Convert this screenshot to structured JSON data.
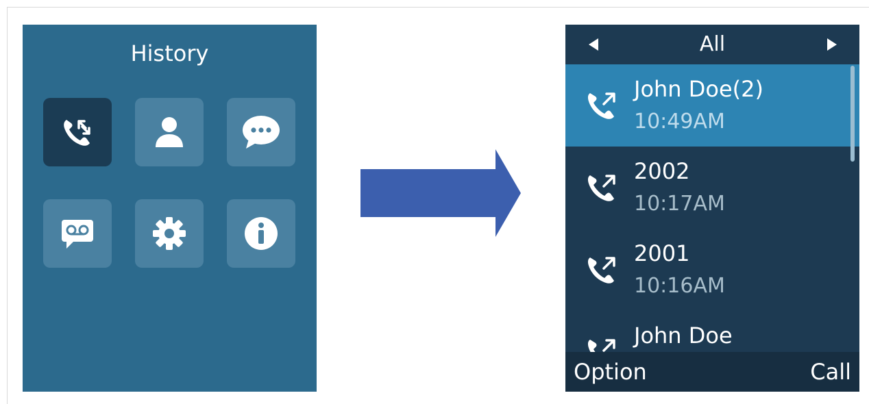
{
  "left_screen": {
    "title": "History",
    "tiles": [
      {
        "icon": "call-history-icon",
        "selected": true
      },
      {
        "icon": "contacts-icon",
        "selected": false
      },
      {
        "icon": "messages-icon",
        "selected": false
      },
      {
        "icon": "voicemail-icon",
        "selected": false
      },
      {
        "icon": "settings-gear-icon",
        "selected": false
      },
      {
        "icon": "info-icon",
        "selected": false
      }
    ]
  },
  "arrow": {
    "icon": "right-arrow-icon",
    "color": "#3c5fae"
  },
  "right_screen": {
    "header": {
      "title": "All",
      "prev_icon": "triangle-left-icon",
      "next_icon": "triangle-right-icon"
    },
    "calls": [
      {
        "name": "John Doe(2)",
        "time": "10:49AM",
        "icon": "outgoing-call-icon",
        "selected": true
      },
      {
        "name": "2002",
        "time": "10:17AM",
        "icon": "outgoing-call-icon",
        "selected": false
      },
      {
        "name": "2001",
        "time": "10:16AM",
        "icon": "outgoing-call-icon",
        "selected": false
      },
      {
        "name": "John Doe",
        "time": "",
        "icon": "outgoing-call-icon",
        "selected": false
      }
    ],
    "softkeys": {
      "left": "Option",
      "right": "Call"
    }
  },
  "colors": {
    "left_bg": "#2c6a8d",
    "tile_bg": "#4a81a1",
    "tile_selected_bg": "#1b3c54",
    "right_bg": "#1d3a52",
    "row_selected_bg": "#2d84b3",
    "softkey_bar_bg": "#172e41"
  }
}
